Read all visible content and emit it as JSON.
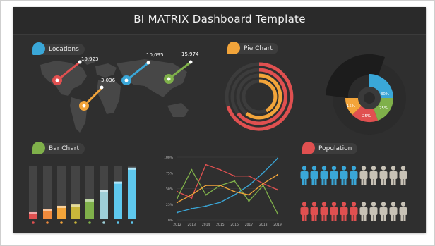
{
  "header": {
    "title": "BI MATRIX Dashboard Template"
  },
  "sections": {
    "locations": {
      "label": "Locations",
      "color": "#3aa7d8"
    },
    "pie": {
      "label": "Pie Chart",
      "color": "#f2a43a"
    },
    "bar": {
      "label": "Bar Chart",
      "color": "#7fb04a"
    },
    "population": {
      "label": "Population",
      "color": "#e05050"
    }
  },
  "locations": {
    "pins": [
      {
        "value": "19,923",
        "color": "#e05050"
      },
      {
        "value": "3,036",
        "color": "#f2a43a"
      },
      {
        "value": "10,095",
        "color": "#3aa7d8"
      },
      {
        "value": "15,974",
        "color": "#7fb04a"
      }
    ]
  },
  "donut_labels": [
    "30%",
    "25%",
    "25%",
    "15%"
  ],
  "chart_data": [
    {
      "type": "bar",
      "values": [
        10,
        15,
        20,
        22,
        30,
        45,
        58,
        80
      ],
      "colors": [
        "#e05050",
        "#f08a3c",
        "#f2a43a",
        "#c9b63a",
        "#7fb04a",
        "#9ecfd8",
        "#5ec8ee",
        "#5ec8ee"
      ],
      "ylim": [
        0,
        82
      ]
    },
    {
      "type": "line",
      "categories": [
        "2012",
        "2013",
        "2014",
        "2015",
        "2016",
        "2017",
        "2018",
        "2019"
      ],
      "ytick_labels": [
        "0%",
        "25%",
        "50%",
        "75%",
        "100%"
      ],
      "ylim": [
        0,
        100
      ],
      "series": [
        {
          "color": "#3aa7d8",
          "values": [
            12,
            18,
            22,
            28,
            40,
            55,
            75,
            98
          ]
        },
        {
          "color": "#e05050",
          "values": [
            45,
            35,
            88,
            80,
            70,
            70,
            58,
            48
          ]
        },
        {
          "color": "#7fb04a",
          "values": [
            35,
            80,
            40,
            55,
            62,
            30,
            55,
            10
          ]
        },
        {
          "color": "#f2a43a",
          "values": [
            28,
            40,
            55,
            55,
            45,
            40,
            58,
            72
          ]
        }
      ]
    }
  ],
  "population": {
    "row1": {
      "highlight_count": 6,
      "total": 11,
      "color": "#3aa7d8"
    },
    "row2": {
      "highlight_count": 6,
      "total": 11,
      "color": "#e05050"
    },
    "neutral_color": "#c8c2b6"
  }
}
